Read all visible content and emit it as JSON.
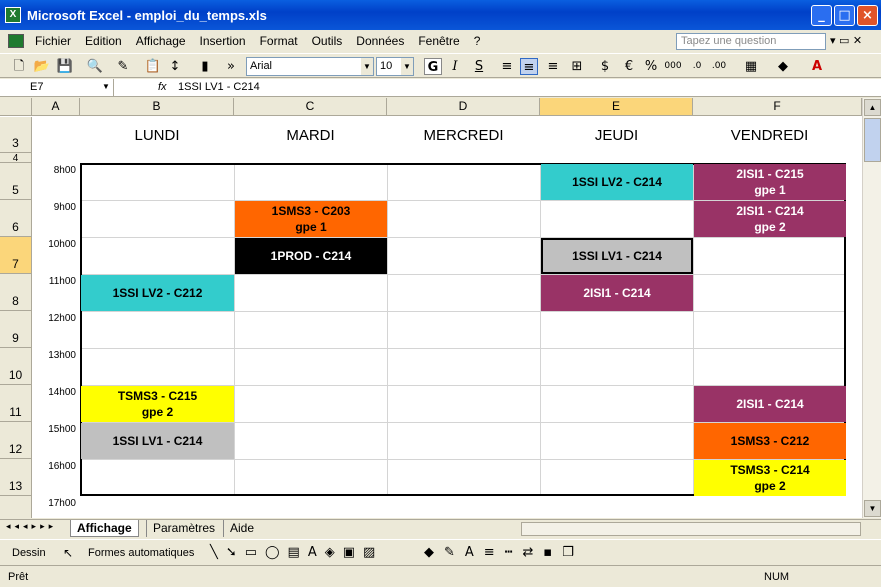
{
  "window": {
    "title": "Microsoft Excel - emploi_du_temps.xls"
  },
  "menu": [
    "Fichier",
    "Edition",
    "Affichage",
    "Insertion",
    "Format",
    "Outils",
    "Données",
    "Fenêtre",
    "?"
  ],
  "help_placeholder": "Tapez une question",
  "toolbar": {
    "font": "Arial",
    "size": "10"
  },
  "formula": {
    "cell": "E7",
    "fx": "fx",
    "value": "1SSI LV1 - C214"
  },
  "columns": [
    "A",
    "B",
    "C",
    "D",
    "E",
    "F"
  ],
  "rows": [
    "3",
    "4",
    "5",
    "6",
    "7",
    "8",
    "9",
    "10",
    "11",
    "12",
    "13"
  ],
  "days": [
    "LUNDI",
    "MARDI",
    "MERCREDI",
    "JEUDI",
    "VENDREDI"
  ],
  "hours": [
    "8h00",
    "9h00",
    "10h00",
    "11h00",
    "12h00",
    "13h00",
    "14h00",
    "15h00",
    "16h00",
    "17h00"
  ],
  "colors": {
    "teal": "#33cccc",
    "plum": "#993366",
    "orange": "#ff6600",
    "black": "#000000",
    "grey": "#c0c0c0",
    "yellow": "#ffff00"
  },
  "slots": [
    {
      "label": "1SSI LV2 - C214",
      "day": 3,
      "row": 0,
      "span": 1,
      "color": "teal",
      "fg": "#000"
    },
    {
      "label": "2ISI1 - C215\ngpe 1",
      "day": 4,
      "row": 0,
      "span": 1,
      "color": "plum",
      "fg": "#fff"
    },
    {
      "label": "1SMS3 - C203\ngpe 1",
      "day": 1,
      "row": 1,
      "span": 1,
      "color": "orange",
      "fg": "#000"
    },
    {
      "label": "2ISI1 - C214\ngpe 2",
      "day": 4,
      "row": 1,
      "span": 1,
      "color": "plum",
      "fg": "#fff"
    },
    {
      "label": "1PROD - C214",
      "day": 1,
      "row": 2,
      "span": 1,
      "color": "black",
      "fg": "#fff"
    },
    {
      "label": "1SSI LV1 - C214",
      "day": 3,
      "row": 2,
      "span": 1,
      "color": "grey",
      "fg": "#000",
      "selected": true
    },
    {
      "label": "1SSI LV2 - C212",
      "day": 0,
      "row": 3,
      "span": 1,
      "color": "teal",
      "fg": "#000"
    },
    {
      "label": "2ISI1 - C214",
      "day": 3,
      "row": 3,
      "span": 1,
      "color": "plum",
      "fg": "#fff"
    },
    {
      "label": "TSMS3 - C215\ngpe 2",
      "day": 0,
      "row": 6,
      "span": 1,
      "color": "yellow",
      "fg": "#000"
    },
    {
      "label": "2ISI1 - C214",
      "day": 4,
      "row": 6,
      "span": 1,
      "color": "plum",
      "fg": "#fff"
    },
    {
      "label": "1SSI LV1 - C214",
      "day": 0,
      "row": 7,
      "span": 1,
      "color": "grey",
      "fg": "#000"
    },
    {
      "label": "1SMS3 - C212",
      "day": 4,
      "row": 7,
      "span": 1,
      "color": "orange",
      "fg": "#000"
    },
    {
      "label": "TSMS3 - C214\ngpe 2",
      "day": 4,
      "row": 8,
      "span": 1,
      "color": "yellow",
      "fg": "#000"
    }
  ],
  "sheets": [
    "Affichage",
    "Paramètres",
    "Aide"
  ],
  "drawbar": {
    "dessin": "Dessin",
    "formes": "Formes automatiques"
  },
  "status": {
    "left": "Prêt",
    "num": "NUM"
  }
}
